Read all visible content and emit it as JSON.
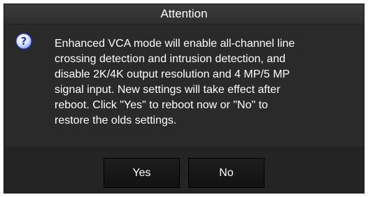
{
  "dialog": {
    "title": "Attention",
    "icon": "question-icon",
    "message": "Enhanced VCA mode will enable all-channel line\ncrossing detection and intrusion detection, and\ndisable 2K/4K output resolution and 4 MP/5 MP\nsignal input. New settings will take effect after\nreboot. Click \"Yes\" to reboot now or \"No\" to\nrestore the olds settings.",
    "buttons": {
      "yes_label": "Yes",
      "no_label": "No"
    }
  },
  "colors": {
    "background": "#2a2a2a",
    "text": "#ffffff",
    "icon_blue": "#2b4fd6"
  }
}
